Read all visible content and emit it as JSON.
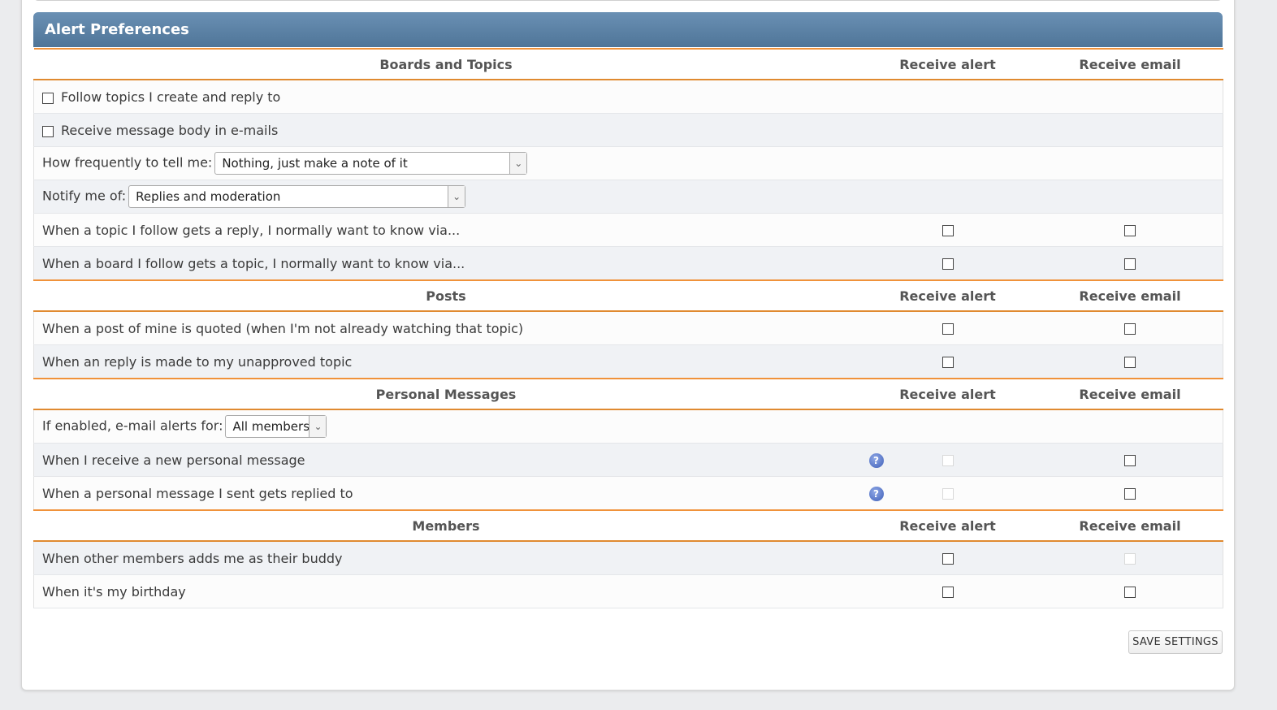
{
  "panel": {
    "title": "Alert Preferences"
  },
  "columns": {
    "alert": "Receive alert",
    "email": "Receive email"
  },
  "sections": {
    "boards": {
      "title": "Boards and Topics",
      "follow_topics": "Follow topics I create and reply to",
      "receive_body": "Receive message body in e-mails",
      "frequency_label": "How frequently to tell me:",
      "frequency_value": "Nothing, just make a note of it",
      "notify_label": "Notify me of:",
      "notify_value": "Replies and moderation",
      "topic_reply": "When a topic I follow gets a reply, I normally want to know via...",
      "board_topic": "When a board I follow gets a topic, I normally want to know via..."
    },
    "posts": {
      "title": "Posts",
      "quoted": "When a post of mine is quoted (when I'm not already watching that topic)",
      "unapproved_reply": "When an reply is made to my unapproved topic"
    },
    "pm": {
      "title": "Personal Messages",
      "email_alerts_label": "If enabled, e-mail alerts for:",
      "email_alerts_value": "All members",
      "new_pm": "When I receive a new personal message",
      "pm_replied": "When a personal message I sent gets replied to"
    },
    "members": {
      "title": "Members",
      "buddy": "When other members adds me as their buddy",
      "birthday": "When it's my birthday"
    }
  },
  "help_icon_glyph": "?",
  "dropdown_glyph": "⌄",
  "save_button": "SAVE SETTINGS",
  "colors": {
    "header_bar": "#5a7fa3",
    "accent_line": "#f0923a"
  }
}
